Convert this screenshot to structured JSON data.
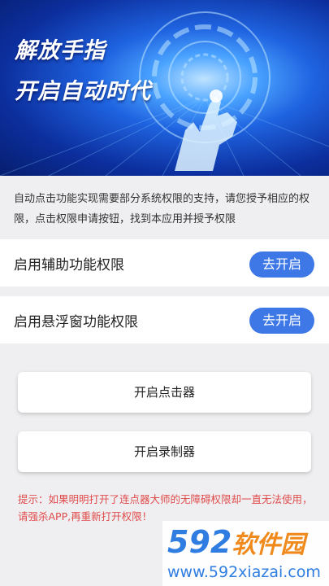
{
  "banner": {
    "slogan_line1": "解放手指",
    "slogan_line2": "开启自动时代"
  },
  "notice": {
    "text": "自动点击功能实现需要部分系统权限的支持，请您授予相应的权限，点击权限申请按钮，找到本应用并授予权限"
  },
  "permissions": [
    {
      "label": "启用辅助功能权限",
      "button": "去开启"
    },
    {
      "label": "启用悬浮窗功能权限",
      "button": "去开启"
    }
  ],
  "actions": {
    "clicker_label": "开启点击器",
    "recorder_label": "开启录制器"
  },
  "tip": {
    "text": "提示：如果明明打开了连点器大师的无障碍权限却一直无法使用，请强杀APP,再重新打开权限！"
  },
  "watermark": {
    "logo_num": "592",
    "logo_name": "软件园",
    "url": "www.592xiazai.com"
  },
  "colors": {
    "accent": "#3e78e6",
    "tip_red": "#e04c4c",
    "banner_blue": "#1f63e0"
  }
}
